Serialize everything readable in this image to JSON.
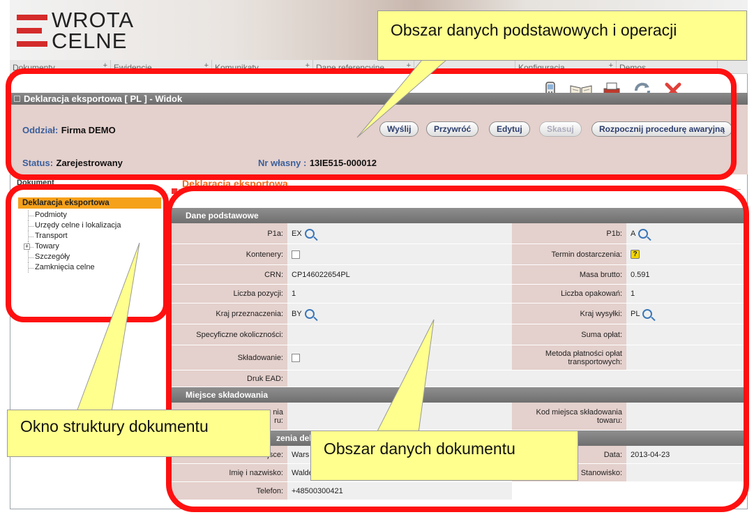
{
  "app": {
    "logo_line1": "WROTA",
    "logo_line2": "CELNE"
  },
  "menu": [
    {
      "label": "Dokumenty"
    },
    {
      "label": "Ewidencje"
    },
    {
      "label": "Komunikaty"
    },
    {
      "label": "Dane referencyjne"
    },
    {
      "label": "Ra"
    },
    {
      "label": "Konfiguracja"
    },
    {
      "label": "Demos"
    }
  ],
  "window_title": "Deklaracja eksportowa [ PL ]  -  Widok",
  "toolbar_icons": [
    "phone-icon",
    "book-icon",
    "print-icon",
    "refresh-icon",
    "close-icon"
  ],
  "operations": {
    "oddzial_label": "Oddział:",
    "oddzial_value": "Firma DEMO",
    "status_label": "Status:",
    "status_value": "Zarejestrowany",
    "nr_label": "Nr własny :",
    "nr_value": "13IE515-000012",
    "buttons": {
      "send": "Wyślij",
      "restore": "Przywróć",
      "edit": "Edytuj",
      "delete": "Skasuj",
      "emergency": "Rozpocznij procedurę awaryjną"
    }
  },
  "tree": {
    "tab_label": "Dokument",
    "selected": "Deklaracja eksportowa",
    "items": [
      "Podmioty",
      "Urzędy celne i lokalizacja",
      "Transport",
      "Towary",
      "Szczegóły",
      "Zamknięcia celne"
    ]
  },
  "doc": {
    "section_title": "Deklaracja eksportowa",
    "band1": "Dane podstawowe",
    "p1a_label": "P1a:",
    "p1a_value": "EX",
    "p1b_label": "P1b:",
    "p1b_value": "A",
    "kontenery_label": "Kontenery:",
    "termin_label": "Termin dostarczenia:",
    "crn_label": "CRN:",
    "crn_value": "CP146022654PL",
    "masa_label": "Masa brutto:",
    "masa_value": "0.591",
    "liczba_poz_label": "Liczba pozycji:",
    "liczba_poz_value": "1",
    "liczba_opak_label": "Liczba opakowań:",
    "liczba_opak_value": "1",
    "kraj_przezn_label": "Kraj przeznaczenia:",
    "kraj_przezn_value": "BY",
    "kraj_wysylki_label": "Kraj wysyłki:",
    "kraj_wysylki_value": "PL",
    "specyficzne_label": "Specyficzne okoliczności:",
    "suma_label": "Suma opłat:",
    "skladowanie_label": "Składowanie:",
    "metoda_label": "Metoda płatności opłat transportowych:",
    "druk_label": "Druk EAD:",
    "band2": "Miejsce składowania",
    "miejsce_partial_label": "nia",
    "miejsce_partial_label2": "ru:",
    "kod_label": "Kod miejsca składowania towaru:",
    "band3_partial": "zenia del",
    "miejsce_label": "Miejsce:",
    "miejsce_value": "Wars",
    "data_label": "Data:",
    "data_value": "2013-04-23",
    "imie_label": "Imię i nazwisko:",
    "imie_value": "Walde",
    "stanowisko_label": "Stanowisko:",
    "telefon_label": "Telefon:",
    "telefon_value": "+48500300421"
  },
  "annotations": {
    "ops": "Obszar danych podstawowych i operacji",
    "tree": "Okno struktury dokumentu",
    "doc": "Obszar danych dokumentu"
  },
  "colors": {
    "annotation_red": "#ff1010",
    "callout_yellow": "#ffff8e",
    "panel_pink": "#e4d0cc",
    "tree_selected": "#f6a11a",
    "section_orange": "#f26a1b"
  }
}
